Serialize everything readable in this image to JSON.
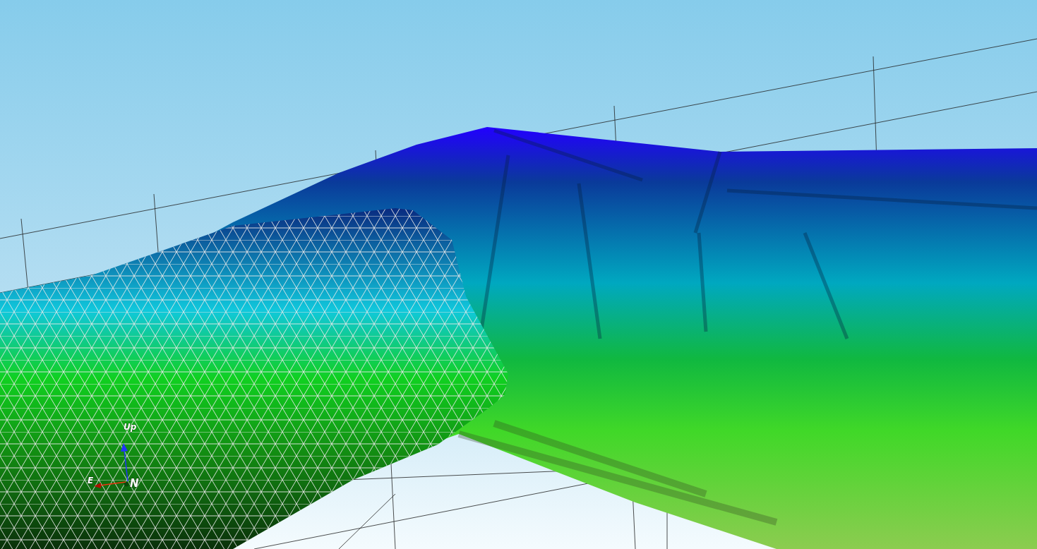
{
  "viewport": {
    "axes": [
      {
        "kind": "up",
        "label": "Up"
      },
      {
        "kind": "east",
        "label": "E"
      },
      {
        "kind": "north",
        "label": "N"
      }
    ]
  }
}
